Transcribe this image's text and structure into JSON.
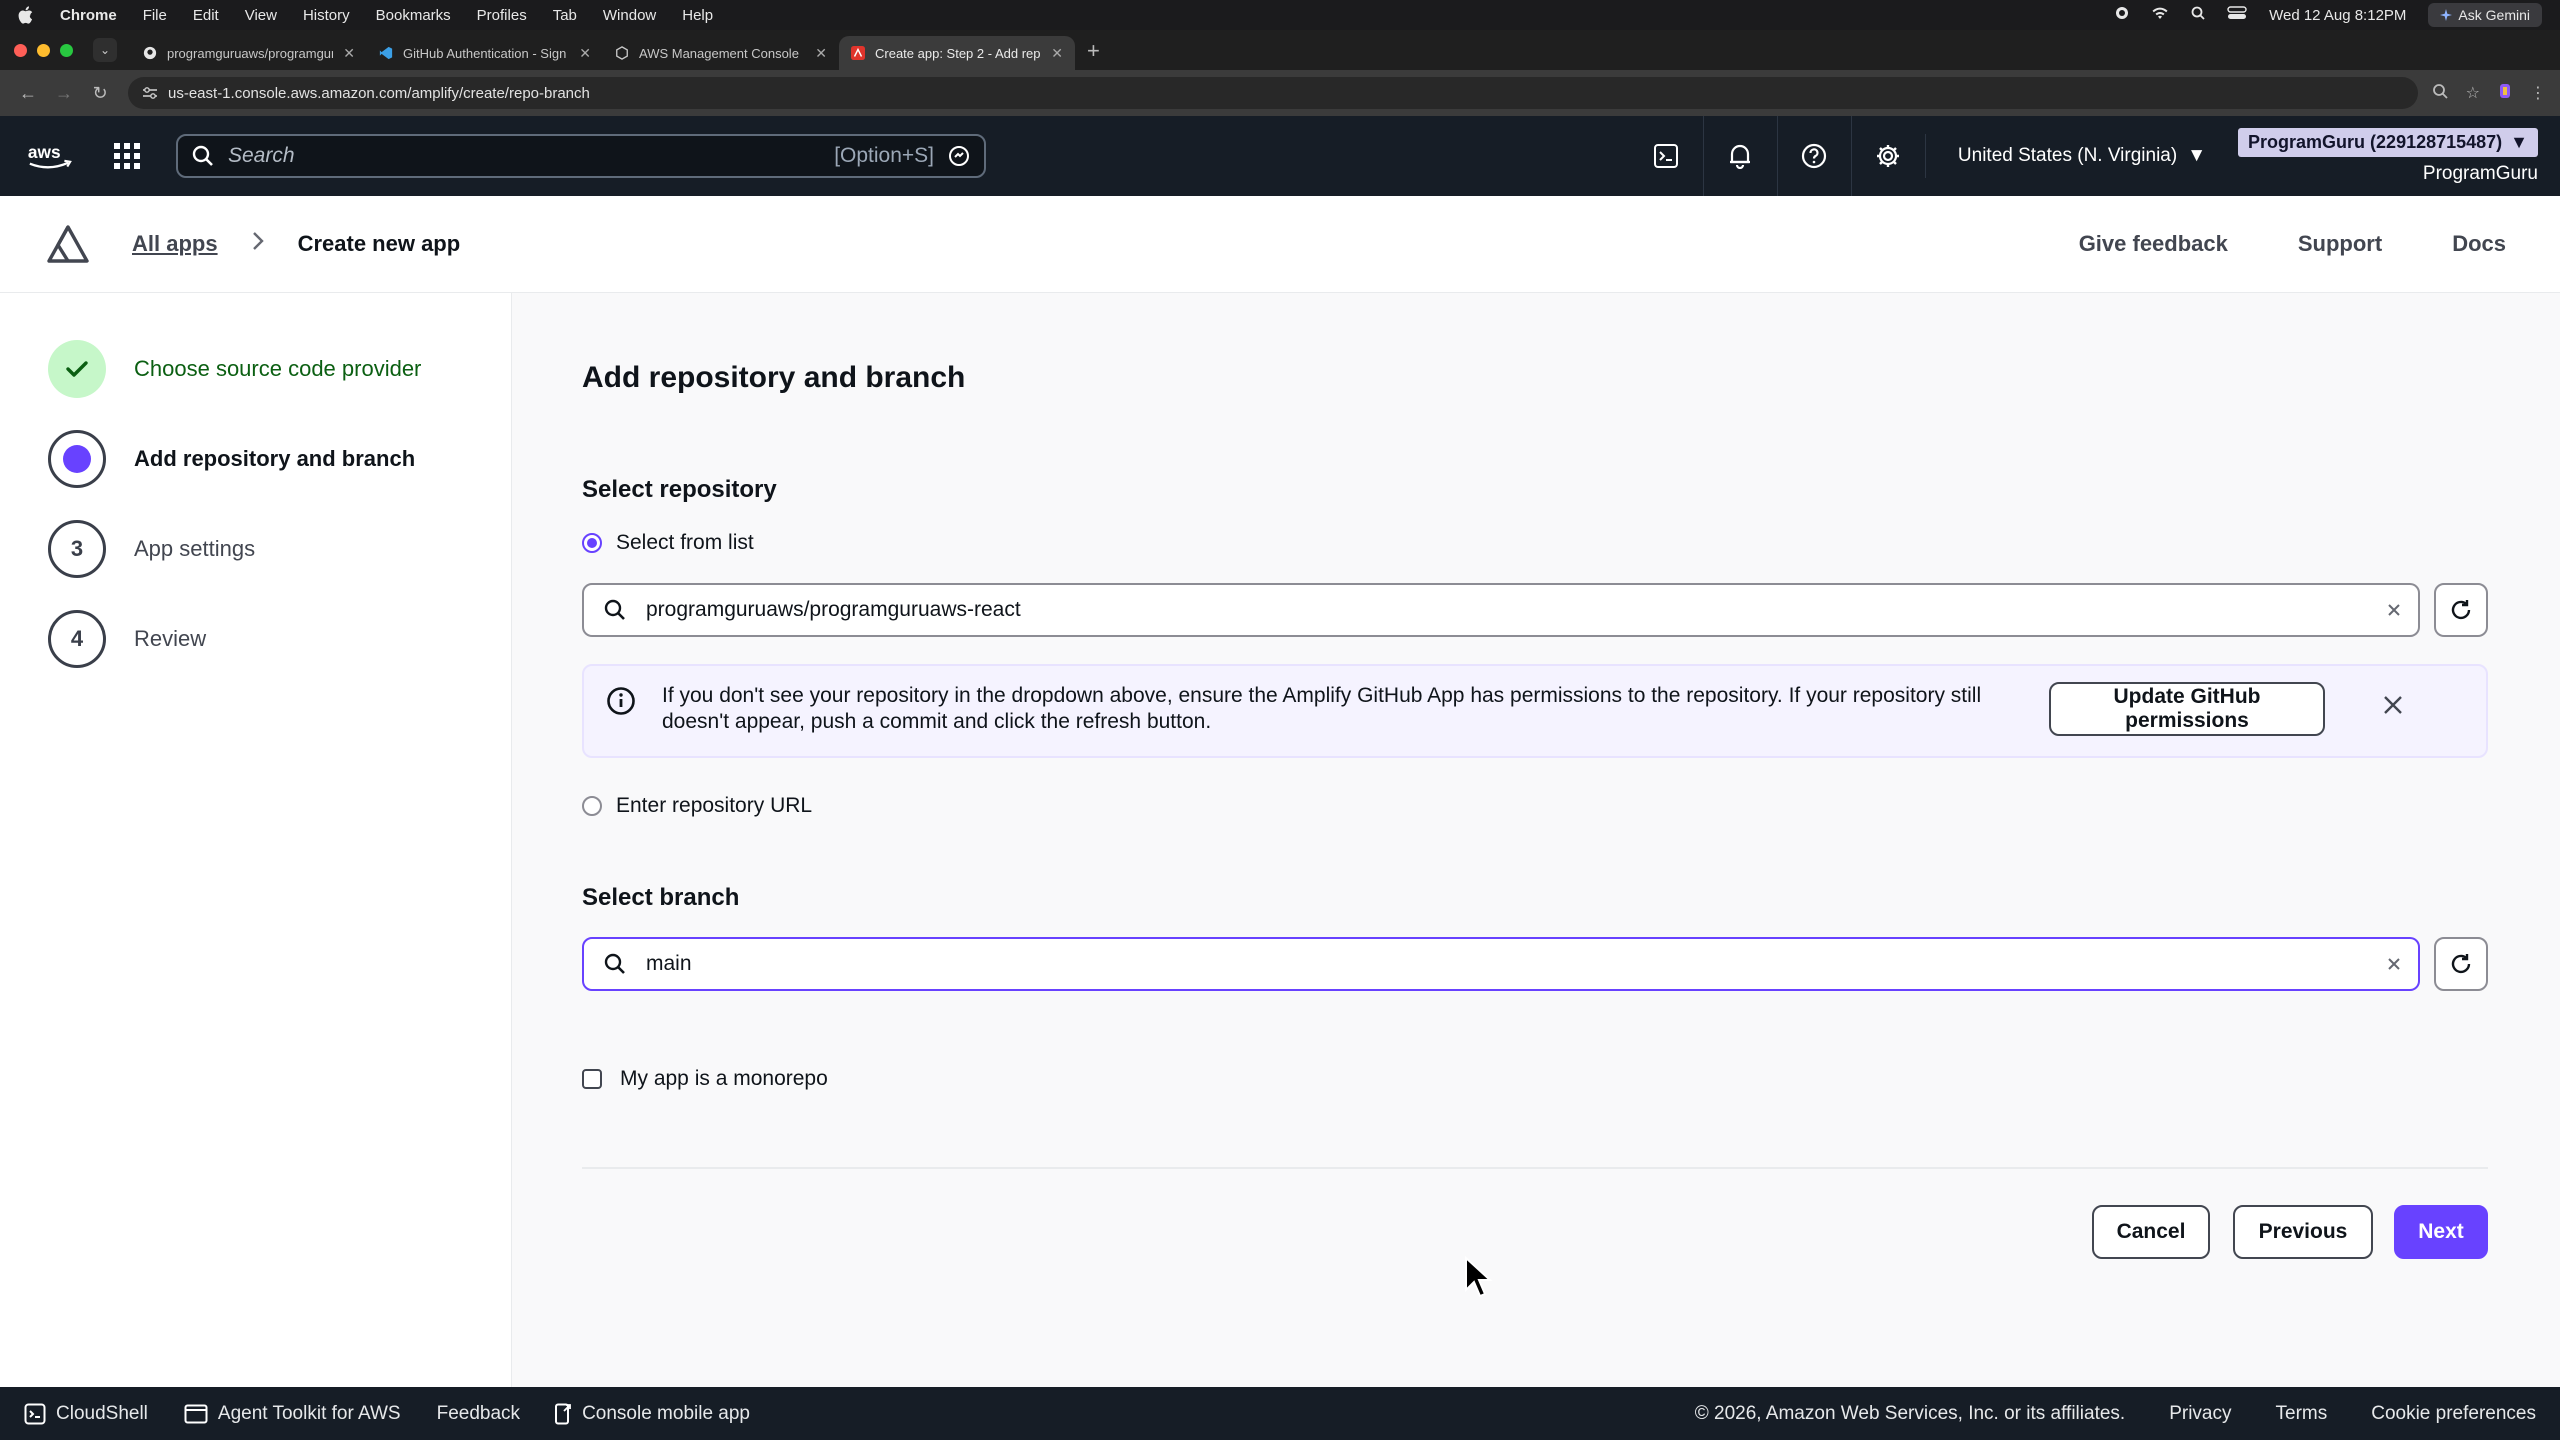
{
  "macos": {
    "app": "Chrome",
    "menus": [
      "File",
      "Edit",
      "View",
      "History",
      "Bookmarks",
      "Profiles",
      "Tab",
      "Window",
      "Help"
    ],
    "datetime": "Wed 12 Aug  8:12PM",
    "ask_gemini": "Ask Gemini"
  },
  "browser": {
    "tabs": [
      {
        "title": "programguruaws/programguruaws"
      },
      {
        "title": "GitHub Authentication - Sign"
      },
      {
        "title": "AWS Management Console"
      },
      {
        "title": "Create app: Step 2 - Add rep"
      }
    ],
    "url": "us-east-1.console.aws.amazon.com/amplify/create/repo-branch"
  },
  "aws_nav": {
    "search_placeholder": "Search",
    "search_shortcut": "[Option+S]",
    "region": "United States (N. Virginia)",
    "account": "ProgramGuru (229128715487)",
    "user": "ProgramGuru"
  },
  "header": {
    "breadcrumb_link": "All apps",
    "breadcrumb_current": "Create new app",
    "links": [
      "Give feedback",
      "Support",
      "Docs"
    ]
  },
  "steps": [
    {
      "number": "",
      "label": "Choose source code provider",
      "state": "done"
    },
    {
      "number": "",
      "label": "Add repository and branch",
      "state": "current"
    },
    {
      "number": "3",
      "label": "App settings",
      "state": "pending"
    },
    {
      "number": "4",
      "label": "Review",
      "state": "pending"
    }
  ],
  "main": {
    "title": "Add repository and branch",
    "repo_section": "Select repository",
    "option_list": "Select from list",
    "repo_value": "programguruaws/programguruaws-react",
    "info_text": "If you don't see your repository in the dropdown above, ensure the Amplify GitHub App has permissions to the repository. If your repository still doesn't appear, push a commit and click the refresh button.",
    "update_button": "Update GitHub permissions",
    "option_url": "Enter repository URL",
    "branch_section": "Select branch",
    "branch_value": "main",
    "monorepo_label": "My app is a monorepo",
    "cancel": "Cancel",
    "previous": "Previous",
    "next": "Next"
  },
  "footer": {
    "cloudshell": "CloudShell",
    "toolkit": "Agent Toolkit for AWS",
    "feedback": "Feedback",
    "mobile": "Console mobile app",
    "copyright": "© 2026, Amazon Web Services, Inc. or its affiliates.",
    "privacy": "Privacy",
    "terms": "Terms",
    "cookies": "Cookie preferences"
  },
  "colors": {
    "accent": "#6842ff",
    "done": "#037f0c",
    "nav_bg": "#161d26"
  }
}
